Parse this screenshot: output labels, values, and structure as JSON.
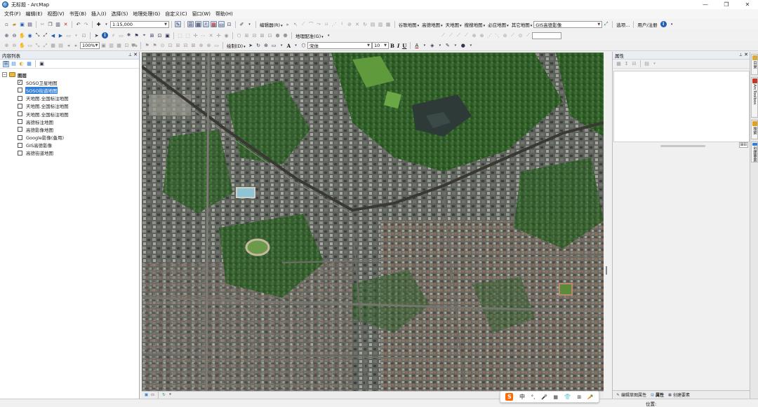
{
  "window": {
    "title": "无标题 - ArcMap",
    "controls": [
      "—",
      "❐",
      "✕"
    ]
  },
  "menubar": {
    "items": [
      "文件(F)",
      "编辑(E)",
      "视图(V)",
      "书签(B)",
      "插入(I)",
      "选择(S)",
      "地理处理(G)",
      "自定义(C)",
      "窗口(W)",
      "帮助(H)"
    ]
  },
  "toolbar": {
    "scale_value": "1:15,000",
    "editor_label": "编辑器(R)",
    "plugin_menus": [
      "谷歌地图",
      "高德地图",
      "天地图",
      "搜搜地图",
      "必应地图",
      "其它地图",
      "GIS高德影像"
    ],
    "options_label": "选项...",
    "user_label": "用户/注册",
    "zoom_value": "100%",
    "georef_label": "地理配准(G)",
    "draw_label": "绘制(D)",
    "font_name": "宋体",
    "font_size": "10",
    "bold": "B",
    "italic": "I",
    "underline": "U",
    "text_tool": "A"
  },
  "toc": {
    "title": "内容列表",
    "group": {
      "label": "图层",
      "expander": "−"
    },
    "layers": [
      {
        "label": "SOSO卫星地图",
        "checked": true,
        "selected": false
      },
      {
        "label": "SOSO街道地图",
        "checked": false,
        "selected": true
      },
      {
        "label": "天地图.全国标注地图",
        "checked": false,
        "selected": false
      },
      {
        "label": "天地图.全国标注地图",
        "checked": false,
        "selected": false
      },
      {
        "label": "天地图.全国标注地图",
        "checked": false,
        "selected": false
      },
      {
        "label": "高德标注地图",
        "checked": false,
        "selected": false
      },
      {
        "label": "高德影像地图",
        "checked": false,
        "selected": false
      },
      {
        "label": "Google影像(备用)",
        "checked": false,
        "selected": false
      },
      {
        "label": "GIS高德影像",
        "checked": false,
        "selected": false
      },
      {
        "label": "高德街道地图",
        "checked": false,
        "selected": false
      }
    ]
  },
  "attributes": {
    "title": "属性",
    "tabs": [
      {
        "label": "编辑草图属性",
        "icon": "sketch-icon"
      },
      {
        "label": "属性",
        "icon": "attributes-icon"
      },
      {
        "label": "创建要素",
        "icon": "create-features-icon"
      }
    ],
    "mini_label": "⊞⊟"
  },
  "dock_tabs": [
    {
      "label": "目录",
      "color": "#d9a93a"
    },
    {
      "label": "ArcToolbox",
      "color": "#c0392b"
    },
    {
      "label": "搜索",
      "color": "#e0a020"
    },
    {
      "label": "创建要素",
      "color": "#2f7ed8"
    }
  ],
  "statusbar": {
    "position_label": "位置:"
  },
  "ime": {
    "logo": "S",
    "lang": "中",
    "items": [
      "°,",
      "🎤",
      "▦",
      "👕",
      "⊞",
      "🥕"
    ]
  },
  "colors": {
    "selection": "#2f7ed8",
    "folder": "#e8b84a",
    "ime_brand": "#ff6a00"
  }
}
